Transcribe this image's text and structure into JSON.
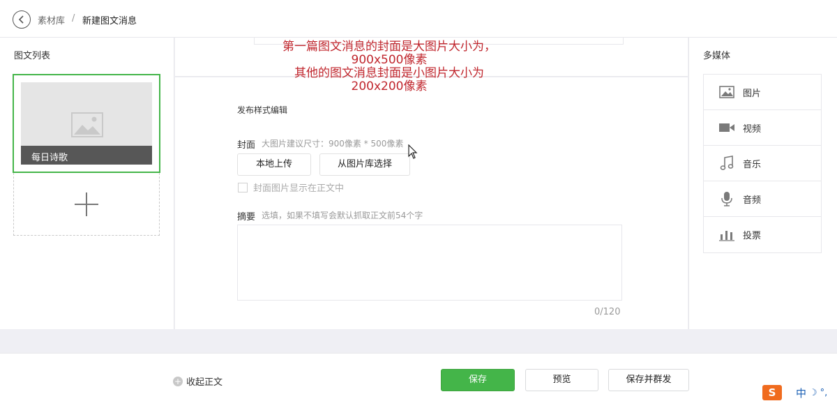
{
  "breadcrumb": {
    "parent": "素材库",
    "separator": "/",
    "current": "新建图文消息"
  },
  "article_list": {
    "title": "图文列表",
    "items": [
      {
        "title": "每日诗歌"
      }
    ]
  },
  "annotation": {
    "line1": "第一篇图文消息的封面是大图片大小为，",
    "line2": "900x500像素",
    "line3": "其他的图文消息封面是小图片大小为",
    "line4": "200x200像素"
  },
  "editor": {
    "section_title": "发布样式编辑",
    "cover_label": "封面",
    "cover_hint": "大图片建议尺寸：900像素 * 500像素",
    "upload_local_label": "本地上传",
    "choose_from_library_label": "从图片库选择",
    "show_cover_in_body_label": "封面图片显示在正文中",
    "show_cover_in_body_checked": false,
    "summary_label": "摘要",
    "summary_hint": "选填，如果不填写会默认抓取正文前54个字",
    "summary_value": "",
    "summary_count": "0/120"
  },
  "multimedia": {
    "title": "多媒体",
    "items": [
      {
        "label": "图片",
        "icon": "image-icon"
      },
      {
        "label": "视频",
        "icon": "video-icon"
      },
      {
        "label": "音乐",
        "icon": "music-icon"
      },
      {
        "label": "音频",
        "icon": "microphone-icon"
      },
      {
        "label": "投票",
        "icon": "vote-icon"
      }
    ]
  },
  "footer": {
    "collapse_label": "收起正文",
    "save_label": "保存",
    "preview_label": "预览",
    "save_and_send_label": "保存并群发"
  },
  "ime": {
    "logo": "S",
    "mode": "中"
  },
  "colors": {
    "accent_green": "#44b549",
    "annotation_red": "#c0262d",
    "background_grey": "#efeff4"
  }
}
